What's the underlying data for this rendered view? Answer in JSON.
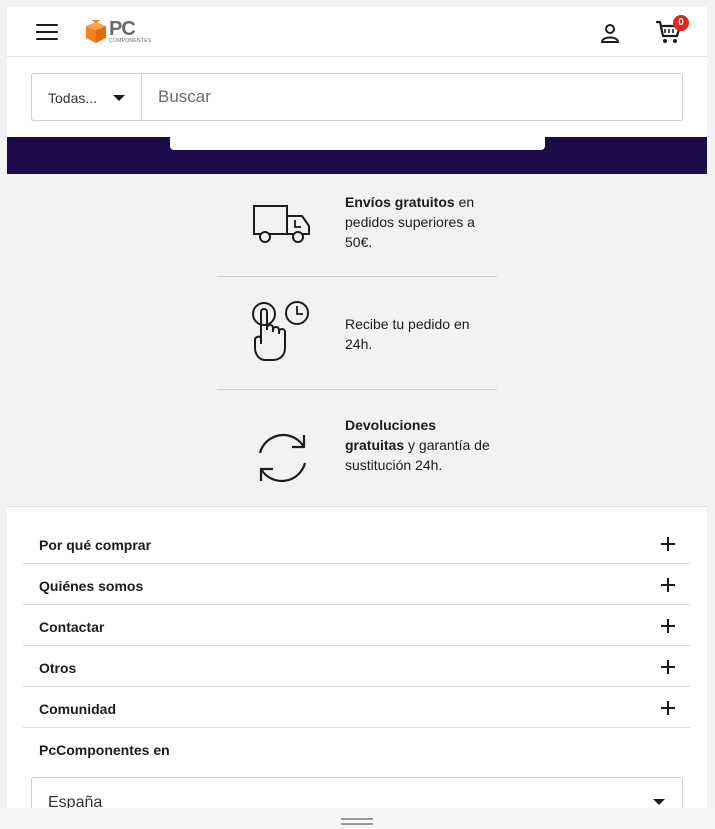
{
  "header": {
    "menu_icon": "hamburger-icon",
    "logo_text": "PC",
    "logo_subtext": "COMPONENTES",
    "user_icon": "user-icon",
    "cart_icon": "cart-icon",
    "cart_count": "0"
  },
  "search": {
    "category_label": "Todas...",
    "placeholder": "Buscar"
  },
  "features": [
    {
      "icon": "truck-icon",
      "bold": "Envíos gratuitos",
      "text": " en pedidos superiores a 50€."
    },
    {
      "icon": "tap-clock-icon",
      "bold": "",
      "text": "Recibe tu pedido en 24h."
    },
    {
      "icon": "refresh-icon",
      "bold": "Devoluciones gratuitas",
      "text": " y garantía de sustitución 24h."
    }
  ],
  "accordion": [
    {
      "label": "Por qué comprar"
    },
    {
      "label": "Quiénes somos"
    },
    {
      "label": "Contactar"
    },
    {
      "label": "Otros"
    },
    {
      "label": "Comunidad"
    }
  ],
  "country": {
    "title": "PcComponentes en",
    "selected": "España"
  },
  "colors": {
    "brand_orange": "#f58220",
    "banner_navy": "#1c0c4c",
    "badge_red": "#e1261c"
  }
}
